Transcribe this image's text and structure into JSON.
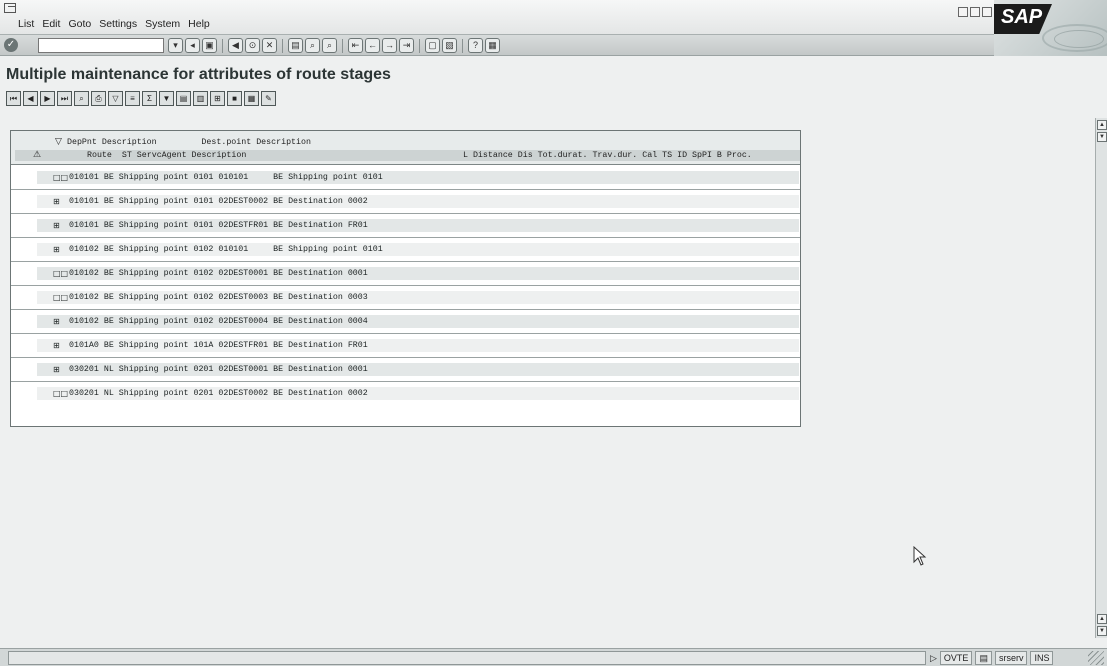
{
  "menu": [
    "List",
    "Edit",
    "Goto",
    "Settings",
    "System",
    "Help"
  ],
  "logo": "SAP",
  "command_field": {
    "value": ""
  },
  "title": "Multiple maintenance for attributes of route stages",
  "header": {
    "line1": "DepPnt Description         Dest.point Description",
    "line2_left": "Route  ST ServcAgent Description",
    "line2_right": "L Distance Dis Tot.durat. Trav.dur. Cal TS ID SpPI B Proc."
  },
  "rows": [
    {
      "icon": "□□",
      "text": "010101 BE Shipping point 0101 010101     BE Shipping point 0101"
    },
    {
      "icon": "⊞",
      "text": "010101 BE Shipping point 0101 02DEST0002 BE Destination 0002"
    },
    {
      "icon": "⊞",
      "text": "010101 BE Shipping point 0101 02DESTFR01 BE Destination FR01"
    },
    {
      "icon": "⊞",
      "text": "010102 BE Shipping point 0102 010101     BE Shipping point 0101"
    },
    {
      "icon": "□□",
      "text": "010102 BE Shipping point 0102 02DEST0001 BE Destination 0001"
    },
    {
      "icon": "□□",
      "text": "010102 BE Shipping point 0102 02DEST0003 BE Destination 0003"
    },
    {
      "icon": "⊞",
      "text": "010102 BE Shipping point 0102 02DEST0004 BE Destination 0004"
    },
    {
      "icon": "⊞",
      "text": "0101A0 BE Shipping point 101A 02DESTFR01 BE Destination FR01"
    },
    {
      "icon": "⊞",
      "text": "030201 NL Shipping point 0201 02DEST0001 BE Destination 0001"
    },
    {
      "icon": "□□",
      "text": "030201 NL Shipping point 0201 02DEST0002 BE Destination 0002"
    }
  ],
  "status": {
    "message": "",
    "transaction": "OVTE",
    "server": "srserv",
    "mode": "INS"
  }
}
